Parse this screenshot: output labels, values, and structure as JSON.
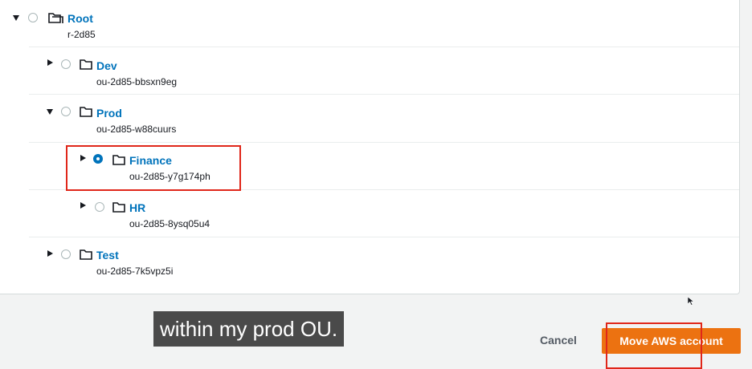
{
  "tree": [
    {
      "name": "Root",
      "id": "r-2d85",
      "expanded": true,
      "selected": false,
      "icon": "root-icon"
    },
    {
      "name": "Dev",
      "id": "ou-2d85-bbsxn9eg",
      "expanded": false,
      "selected": false,
      "icon": "folder-icon"
    },
    {
      "name": "Prod",
      "id": "ou-2d85-w88cuurs",
      "expanded": true,
      "selected": false,
      "icon": "folder-icon"
    },
    {
      "name": "Finance",
      "id": "ou-2d85-y7g174ph",
      "expanded": false,
      "selected": true,
      "icon": "folder-icon"
    },
    {
      "name": "HR",
      "id": "ou-2d85-8ysq05u4",
      "expanded": false,
      "selected": false,
      "icon": "folder-icon"
    },
    {
      "name": "Test",
      "id": "ou-2d85-7k5vpz5i",
      "expanded": false,
      "selected": false,
      "icon": "folder-icon"
    }
  ],
  "footer": {
    "cancel_label": "Cancel",
    "primary_label": "Move AWS account"
  },
  "caption": "within my prod OU.",
  "colors": {
    "link": "#0073bb",
    "primary_button": "#ec7211",
    "highlight": "#e0271a"
  }
}
